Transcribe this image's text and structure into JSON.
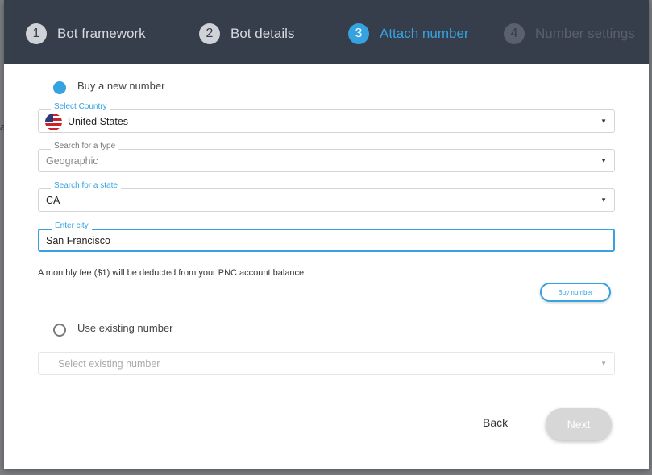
{
  "stepper": {
    "steps": [
      {
        "number": "1",
        "label": "Bot framework",
        "state": "done"
      },
      {
        "number": "2",
        "label": "Bot details",
        "state": "done"
      },
      {
        "number": "3",
        "label": "Attach number",
        "state": "active"
      },
      {
        "number": "4",
        "label": "Number settings",
        "state": "disabled"
      }
    ]
  },
  "buy_new": {
    "label": "Buy a new number",
    "selected": true
  },
  "country": {
    "label": "Select Country",
    "value": "United States"
  },
  "type": {
    "label": "Search for a type",
    "value": "Geographic"
  },
  "state": {
    "label": "Search for a state",
    "value": "CA"
  },
  "city": {
    "label": "Enter city",
    "value": "San Francisco"
  },
  "fee_note": "A monthly fee ($1) will be deducted from your PNC account balance.",
  "buy_button": "Buy number",
  "use_existing": {
    "label": "Use existing number",
    "selected": false
  },
  "existing_select": {
    "placeholder": "Select existing number"
  },
  "footer": {
    "back": "Back",
    "next": "Next"
  },
  "colors": {
    "accent": "#36a2e0",
    "header_bg": "#363d4b"
  }
}
